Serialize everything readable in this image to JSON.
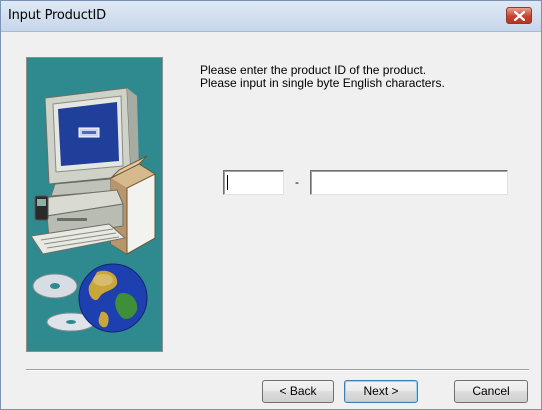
{
  "window": {
    "title": "Input ProductID"
  },
  "dialog": {
    "message_line1": "Please enter the product ID of the product.",
    "message_line2": "Please input in single byte English characters.",
    "separator": "-",
    "product_id_part1": "",
    "product_id_part2": ""
  },
  "buttons": {
    "back_label": "< Back",
    "next_label": "Next >",
    "cancel_label": "Cancel"
  },
  "icons": {
    "close": "close-icon",
    "illustration": "computer-globe-illustration"
  },
  "colors": {
    "illustration_background": "#2e8a8e",
    "close_button": "#c7432e",
    "dialog_background": "#f0f0f0"
  }
}
